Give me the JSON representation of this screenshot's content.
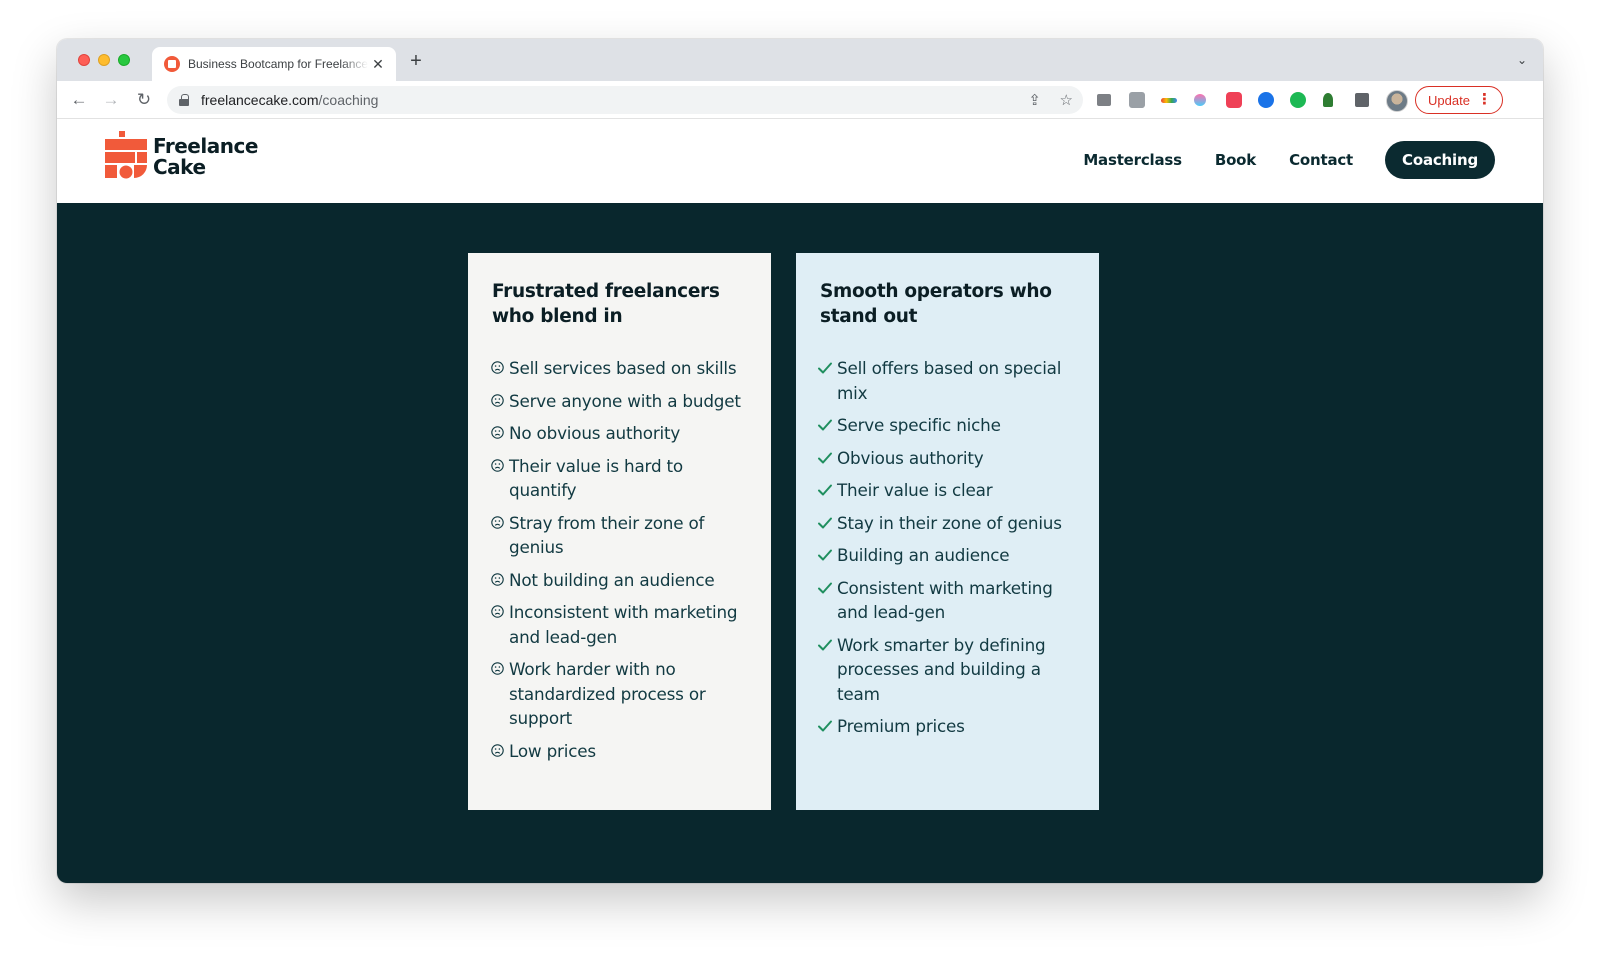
{
  "browser": {
    "tab_title": "Business Bootcamp for Freelancers",
    "tab_close": "✕",
    "new_tab": "+",
    "tabs_menu": "⌄",
    "back": "←",
    "forward": "→",
    "reload": "↻",
    "url_host": "freelancecake.com",
    "url_path": "/coaching",
    "share_icon": "⇪",
    "star_icon": "☆",
    "update_label": "Update",
    "update_menu": "⋮"
  },
  "site": {
    "logo_line1": "Freelance",
    "logo_line2": "Cake",
    "brand_color": "#f15a3a",
    "nav": {
      "masterclass": "Masterclass",
      "book": "Book",
      "contact": "Contact",
      "coaching": "Coaching"
    }
  },
  "comparison": {
    "left": {
      "title": "Frustrated freelancers who blend in",
      "items": [
        "Sell services based on skills",
        "Serve anyone with a budget",
        "No obvious authority",
        "Their value is hard to quantify",
        "Stray from their zone of genius",
        "Not building an audience",
        "Inconsistent with marketing and lead-gen",
        "Work harder with no standardized process or support",
        "Low prices"
      ]
    },
    "right": {
      "title": "Smooth operators who stand out",
      "items": [
        "Sell offers based on special mix",
        "Serve specific niche",
        "Obvious authority",
        "Their value is clear",
        "Stay in their zone of genius",
        "Building an audience",
        "Consistent with marketing and lead-gen",
        "Work smarter by defining processes and building a team",
        "Premium prices"
      ]
    }
  },
  "colors": {
    "page_bg": "#09272d",
    "card_left_bg": "#f5f5f3",
    "card_right_bg": "#dfeef5",
    "check_color": "#1f8f5f",
    "cta_bg": "#0b2a30"
  }
}
